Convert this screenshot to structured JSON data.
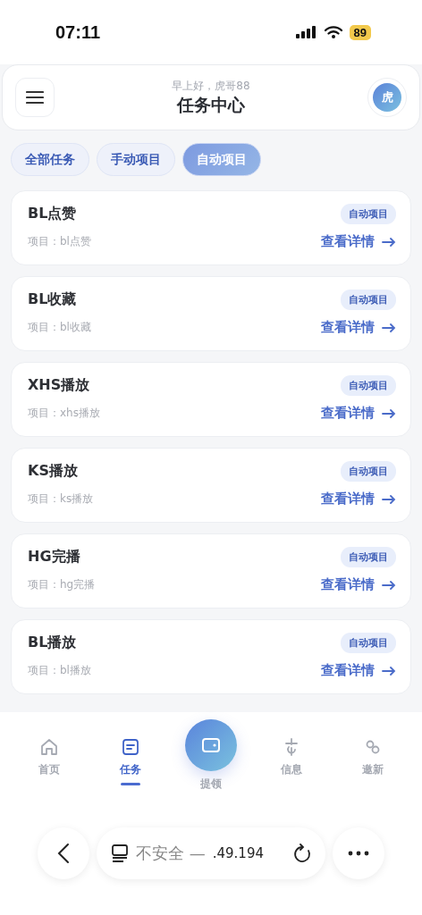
{
  "status_bar": {
    "time": "07:11",
    "battery": "89"
  },
  "header": {
    "greeting": "早上好，虎哥88",
    "title": "任务中心",
    "avatar": "虎"
  },
  "filters": [
    {
      "label": "全部任务",
      "selected": false
    },
    {
      "label": "手动项目",
      "selected": false
    },
    {
      "label": "自动项目",
      "selected": true
    }
  ],
  "tasks": [
    {
      "name": "BL点赞",
      "project": "项目：bl点赞",
      "tag": "自动项目",
      "link": "查看详情"
    },
    {
      "name": "BL收藏",
      "project": "项目：bl收藏",
      "tag": "自动项目",
      "link": "查看详情"
    },
    {
      "name": "XHS播放",
      "project": "项目：xhs播放",
      "tag": "自动项目",
      "link": "查看详情"
    },
    {
      "name": "KS播放",
      "project": "项目：ks播放",
      "tag": "自动项目",
      "link": "查看详情"
    },
    {
      "name": "HG完播",
      "project": "项目：hg完播",
      "tag": "自动项目",
      "link": "查看详情"
    },
    {
      "name": "BL播放",
      "project": "项目：bl播放",
      "tag": "自动项目",
      "link": "查看详情"
    }
  ],
  "bottom_nav": [
    {
      "label": "首页",
      "kind": "home",
      "selected": false
    },
    {
      "label": "任务",
      "kind": "tasks",
      "selected": true
    },
    {
      "label": "提领",
      "kind": "wallet",
      "selected": false
    },
    {
      "label": "信息",
      "kind": "info",
      "selected": false
    },
    {
      "label": "邀新",
      "kind": "invite",
      "selected": false
    }
  ],
  "browser_bar": {
    "security": "不安全 —",
    "host": ".49.194"
  }
}
